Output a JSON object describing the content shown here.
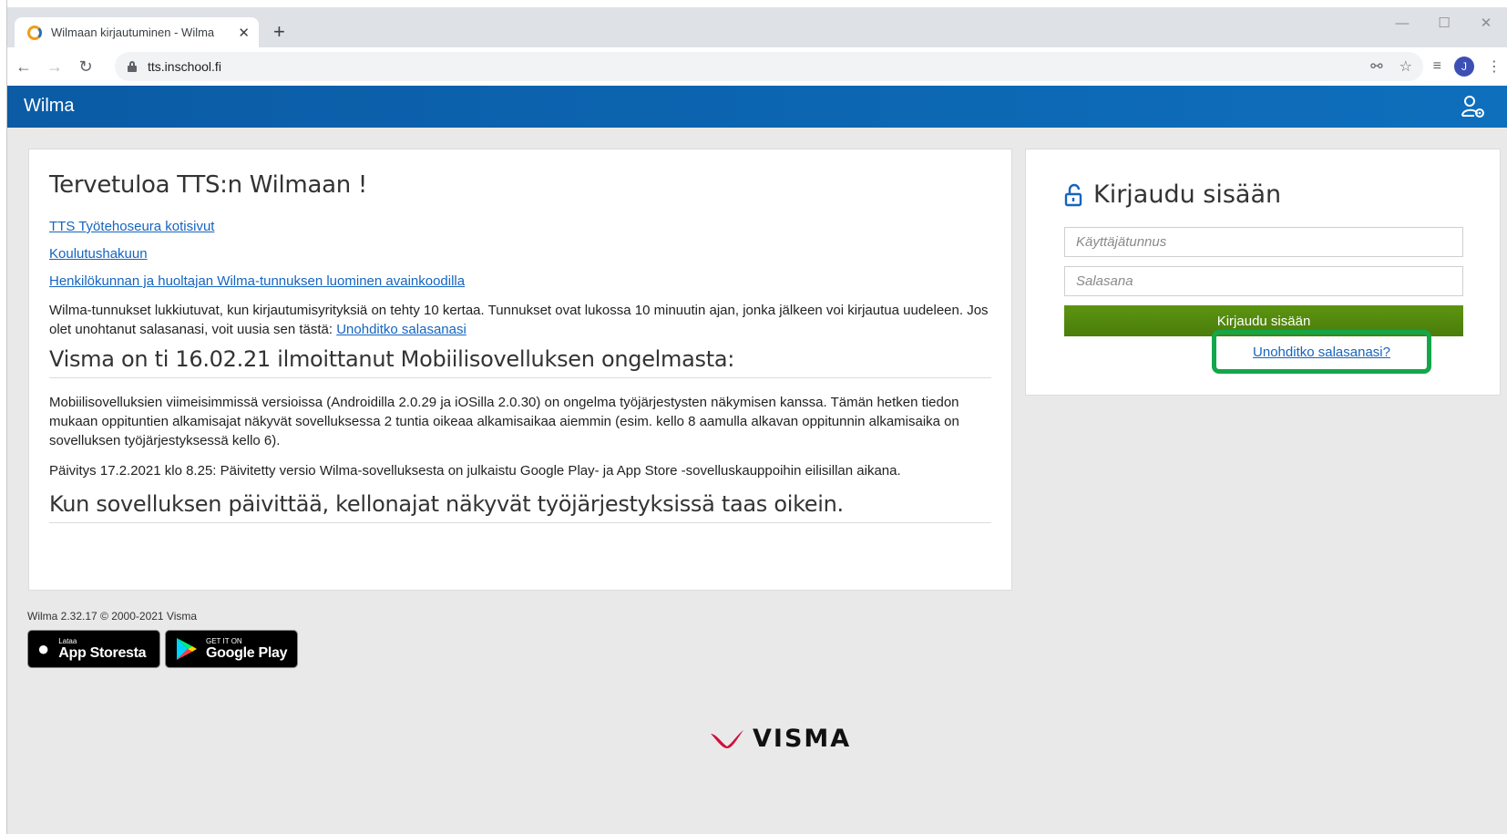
{
  "browser": {
    "tab_title": "Wilmaan kirjautuminen - Wilma",
    "tab_close": "✕",
    "new_tab": "+",
    "url": "tts.inschool.fi",
    "profile_initial": "J",
    "window_controls": [
      "—",
      "☐",
      "✕"
    ],
    "icons": [
      "back-arrow-icon",
      "forward-arrow-icon",
      "reload-icon",
      "lock-icon",
      "key-icon",
      "star-icon",
      "reading-list-icon",
      "more-vert-icon"
    ]
  },
  "header": {
    "brand": "Wilma",
    "bg_color": "#0b5ba5",
    "icon": "user-settings-icon"
  },
  "main": {
    "title": "Tervetuloa TTS:n Wilmaan !",
    "links": [
      "TTS Työtehoseura kotisivut",
      "Koulutushakuun",
      "Henkilökunnan ja huoltajan Wilma-tunnuksen luominen avainkoodilla"
    ],
    "lock_notice": "Wilma-tunnukset lukkiutuvat, kun kirjautumisyrityksiä on tehty 10 kertaa. Tunnukset ovat lukossa 10 minuutin ajan, jonka jälkeen voi kirjautua uudeleen. Jos olet unohtanut salasanasi, voit uusia sen tästä: ",
    "lock_notice_link": "Unohditko salasanasi",
    "heading_1": "Visma on ti 16.02.21 ilmoittanut Mobiilisovelluksen ongelmasta:",
    "paragraph_1": "Mobiilisovelluksien viimeisimmissä versioissa (Androidilla 2.0.29 ja iOSilla 2.0.30) on ongelma työjärjestysten näkymisen kanssa. Tämän hetken tiedon mukaan oppituntien alkamisajat näkyvät sovelluksessa 2 tuntia oikeaa alkamisaikaa aiemmin (esim. kello 8 aamulla alkavan oppitunnin alkamisaika on sovelluksen työjärjestyksessä kello 6).",
    "paragraph_2": "Päivitys 17.2.2021 klo 8.25: Päivitetty versio Wilma-sovelluksesta on julkaistu Google Play- ja App Store -sovelluskauppoihin eilisillan aikana.",
    "heading_2": "Kun sovelluksen päivittää, kellonajat näkyvät työjärjestyksissä taas oikein."
  },
  "login": {
    "title": "Kirjaudu sisään",
    "username_placeholder": "Käyttäjätunnus",
    "password_placeholder": "Salasana",
    "submit_label": "Kirjaudu sisään",
    "forgot_label": "Unohditko salasanasi?",
    "button_color": "#4a7d0a",
    "highlight_color": "#13a74a"
  },
  "footer": {
    "version": "Wilma 2.32.17 © 2000-2021 Visma",
    "appstore_small": "Lataa",
    "appstore_big": "App Storesta",
    "googleplay_small": "GET IT ON",
    "googleplay_big": "Google Play",
    "visma_logo": "VISMA"
  }
}
